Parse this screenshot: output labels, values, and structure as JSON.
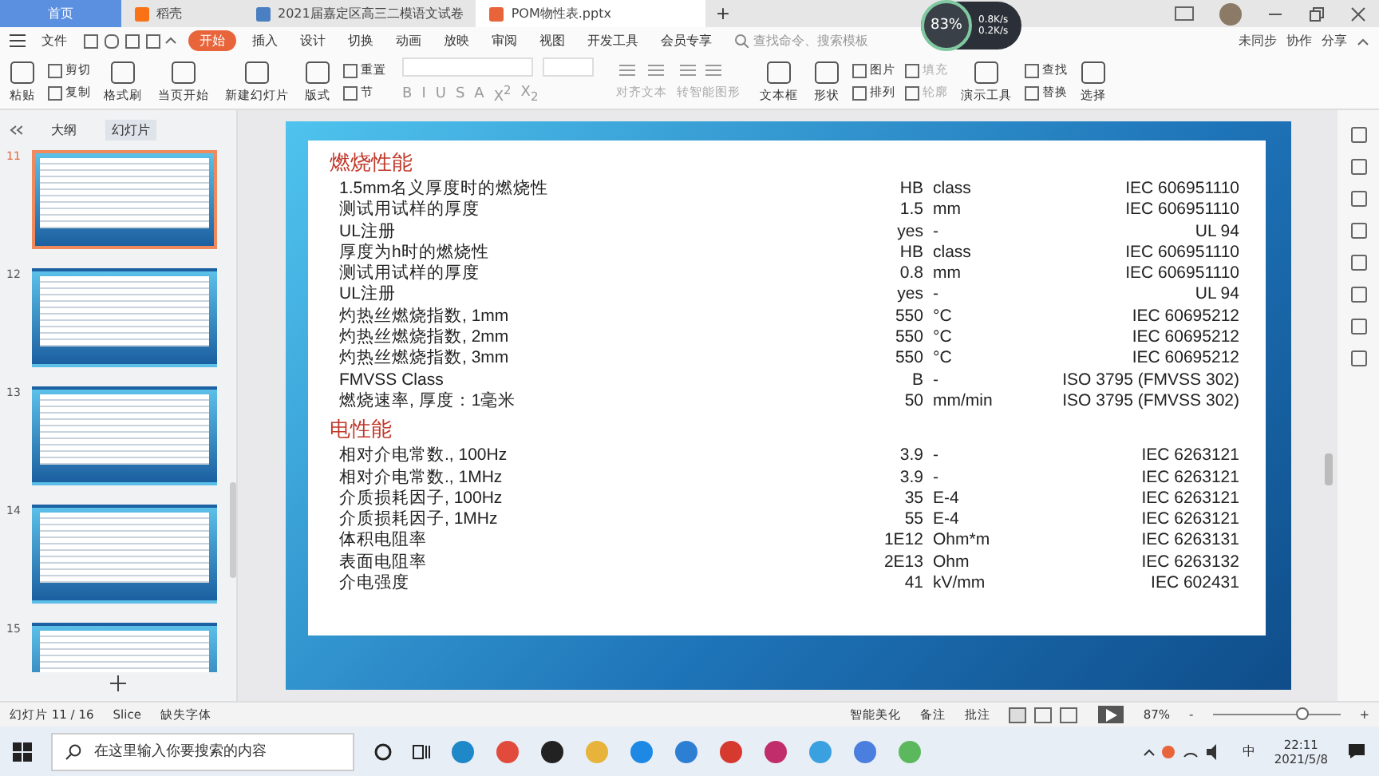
{
  "tabs": [
    {
      "label": "首页",
      "kind": "home",
      "selected": false
    },
    {
      "label": "稻壳",
      "kind": "app",
      "selected": false
    },
    {
      "label": "2021届嘉定区高三二模语文试卷",
      "kind": "doc",
      "selected": false
    },
    {
      "label": "POM物性表.pptx",
      "kind": "ppt",
      "selected": true
    }
  ],
  "new_tab": "+",
  "network": {
    "percent": "83%",
    "upload": "0.8K/s",
    "download": "0.2K/s"
  },
  "file_menu": "文件",
  "menu": [
    {
      "label": "开始",
      "selected": true
    },
    {
      "label": "插入",
      "selected": false
    },
    {
      "label": "设计",
      "selected": false
    },
    {
      "label": "切换",
      "selected": false
    },
    {
      "label": "动画",
      "selected": false
    },
    {
      "label": "放映",
      "selected": false
    },
    {
      "label": "审阅",
      "selected": false
    },
    {
      "label": "视图",
      "selected": false
    },
    {
      "label": "开发工具",
      "selected": false
    },
    {
      "label": "会员专享",
      "selected": false
    }
  ],
  "search": {
    "placeholder": "查找命令、搜索模板"
  },
  "account_actions": [
    "未同步",
    "协作",
    "分享"
  ],
  "ribbon_left": [
    [
      {
        "label": "粘贴",
        "disabled": false
      }
    ],
    [
      {
        "label": "剪切",
        "disabled": false
      },
      {
        "label": "复制",
        "disabled": false
      }
    ],
    [
      {
        "label": "格式刷",
        "disabled": false
      }
    ],
    [
      {
        "label": "当页开始",
        "disabled": false
      }
    ],
    [
      {
        "label": "新建幻灯片",
        "disabled": false
      }
    ],
    [
      {
        "label": "版式",
        "disabled": false
      }
    ],
    [
      {
        "label": "重置",
        "disabled": false
      },
      {
        "label": "节",
        "disabled": false
      }
    ]
  ],
  "format_buttons": [
    "B",
    "I",
    "U",
    "S",
    "A",
    "X$^{2}$",
    "X$_{2}$"
  ],
  "paragraph_actions": [
    {
      "label": "对齐文本",
      "disabled": true
    },
    {
      "label": "转智能图形",
      "disabled": true
    }
  ],
  "ribbon_right": [
    [
      {
        "label": "文本框",
        "disabled": false
      }
    ],
    [
      {
        "label": "形状",
        "disabled": false
      }
    ],
    [
      {
        "label": "图片",
        "disabled": false
      },
      {
        "label": "排列",
        "disabled": false
      }
    ],
    [
      {
        "label": "填充",
        "disabled": true
      },
      {
        "label": "轮廓",
        "disabled": true
      }
    ],
    [
      {
        "label": "演示工具",
        "disabled": false
      }
    ],
    [
      {
        "label": "查找",
        "disabled": false
      },
      {
        "label": "替换",
        "disabled": false
      }
    ],
    [
      {
        "label": "选择",
        "disabled": false
      }
    ]
  ],
  "panel_tabs": [
    {
      "label": "大纲",
      "selected": false
    },
    {
      "label": "幻灯片",
      "selected": true
    }
  ],
  "thumbnails": [
    {
      "number": "11",
      "selected": true
    },
    {
      "number": "12",
      "selected": false
    },
    {
      "number": "13",
      "selected": false
    },
    {
      "number": "14",
      "selected": false
    },
    {
      "number": "15",
      "selected": false
    }
  ],
  "slide": {
    "sections": [
      {
        "title": "燃烧性能",
        "rows": [
          {
            "name": "1.5mm名义厚度时的燃烧性",
            "value": "HB",
            "unit": "class",
            "standard": "IEC 606951110"
          },
          {
            "name": "测试用试样的厚度",
            "value": "1.5",
            "unit": "mm",
            "standard": "IEC 606951110"
          },
          {
            "name": "UL注册",
            "value": "yes",
            "unit": "-",
            "standard": "UL 94"
          },
          {
            "name": "厚度为h时的燃烧性",
            "value": "HB",
            "unit": "class",
            "standard": "IEC 606951110"
          },
          {
            "name": "测试用试样的厚度",
            "value": "0.8",
            "unit": "mm",
            "standard": "IEC 606951110"
          },
          {
            "name": "UL注册",
            "value": "yes",
            "unit": "-",
            "standard": "UL 94"
          },
          {
            "name": "灼热丝燃烧指数, 1mm",
            "value": "550",
            "unit": "°C",
            "standard": "IEC 60695212"
          },
          {
            "name": "灼热丝燃烧指数, 2mm",
            "value": "550",
            "unit": "°C",
            "standard": "IEC 60695212"
          },
          {
            "name": "灼热丝燃烧指数, 3mm",
            "value": "550",
            "unit": "°C",
            "standard": "IEC 60695212"
          },
          {
            "name": "FMVSS Class",
            "value": "B",
            "unit": "-",
            "standard": "ISO 3795 (FMVSS 302)"
          },
          {
            "name": "燃烧速率, 厚度：1毫米",
            "value": "50",
            "unit": "mm/min",
            "standard": "ISO 3795 (FMVSS 302)"
          }
        ]
      },
      {
        "title": "电性能",
        "rows": [
          {
            "name": "相对介电常数., 100Hz",
            "value": "3.9",
            "unit": "-",
            "standard": "IEC 6263121"
          },
          {
            "name": "相对介电常数., 1MHz",
            "value": "3.9",
            "unit": "-",
            "standard": "IEC 6263121"
          },
          {
            "name": "介质损耗因子, 100Hz",
            "value": "35",
            "unit": "E-4",
            "standard": "IEC 6263121"
          },
          {
            "name": "介质损耗因子, 1MHz",
            "value": "55",
            "unit": "E-4",
            "standard": "IEC 6263121"
          },
          {
            "name": "体积电阻率",
            "value": "1E12",
            "unit": "Ohm*m",
            "standard": "IEC 6263131"
          },
          {
            "name": "表面电阻率",
            "value": "2E13",
            "unit": "Ohm",
            "standard": "IEC 6263132"
          },
          {
            "name": "介电强度",
            "value": "41",
            "unit": "kV/mm",
            "standard": "IEC 602431"
          }
        ]
      }
    ]
  },
  "status_bar": {
    "slide_count": "幻灯片 11 / 16",
    "theme": "Slice",
    "missing_fonts": "缺失字体",
    "beautify": "智能美化",
    "notes": "备注",
    "comments": "批注",
    "zoom": "87%",
    "zoom_out": "-",
    "zoom_in": "+",
    "zoom_slider": {
      "level": 0.7
    }
  },
  "taskbar": {
    "search_placeholder": "在这里输入你要搜索的内容",
    "ime": "中",
    "time": "22:11",
    "date": "2021/5/8"
  }
}
